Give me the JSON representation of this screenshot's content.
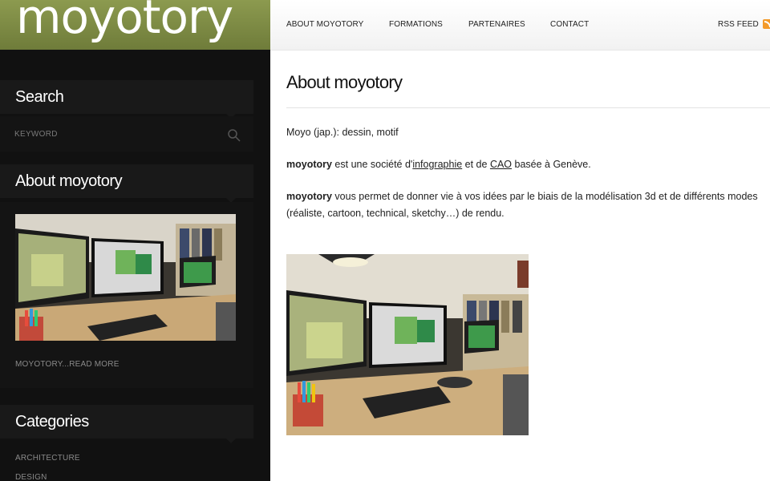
{
  "logo": {
    "text": "moyotory"
  },
  "sidebar": {
    "search": {
      "title": "Search",
      "placeholder": "KEYWORD"
    },
    "about": {
      "title": "About moyotory",
      "read_more": "MOYOTORY...READ MORE"
    },
    "categories": {
      "title": "Categories",
      "items": [
        "ARCHITECTURE",
        "DESIGN"
      ]
    }
  },
  "nav": {
    "items": [
      "ABOUT MOYOTORY",
      "FORMATIONS",
      "PARTENAIRES",
      "CONTACT"
    ],
    "rss": "RSS FEED"
  },
  "content": {
    "title": "About moyotory",
    "line1": "Moyo (jap.): dessin, motif",
    "p2": {
      "bold": "moyotory",
      "t1": " est une société d'",
      "link1": "infographie",
      "t2": " et de ",
      "link2": "CAO",
      "t3": " basée à Genève."
    },
    "p3": {
      "bold": "moyotory",
      "text": " vous permet de donner vie à vos idées par le biais de la modélisation 3d et de différents modes (réaliste, cartoon, technical, sketchy…)  de rendu."
    }
  },
  "colors": {
    "logo_bar": "#7d8a44",
    "sidebar_bg": "#111111",
    "rss": "#f39a2a"
  }
}
